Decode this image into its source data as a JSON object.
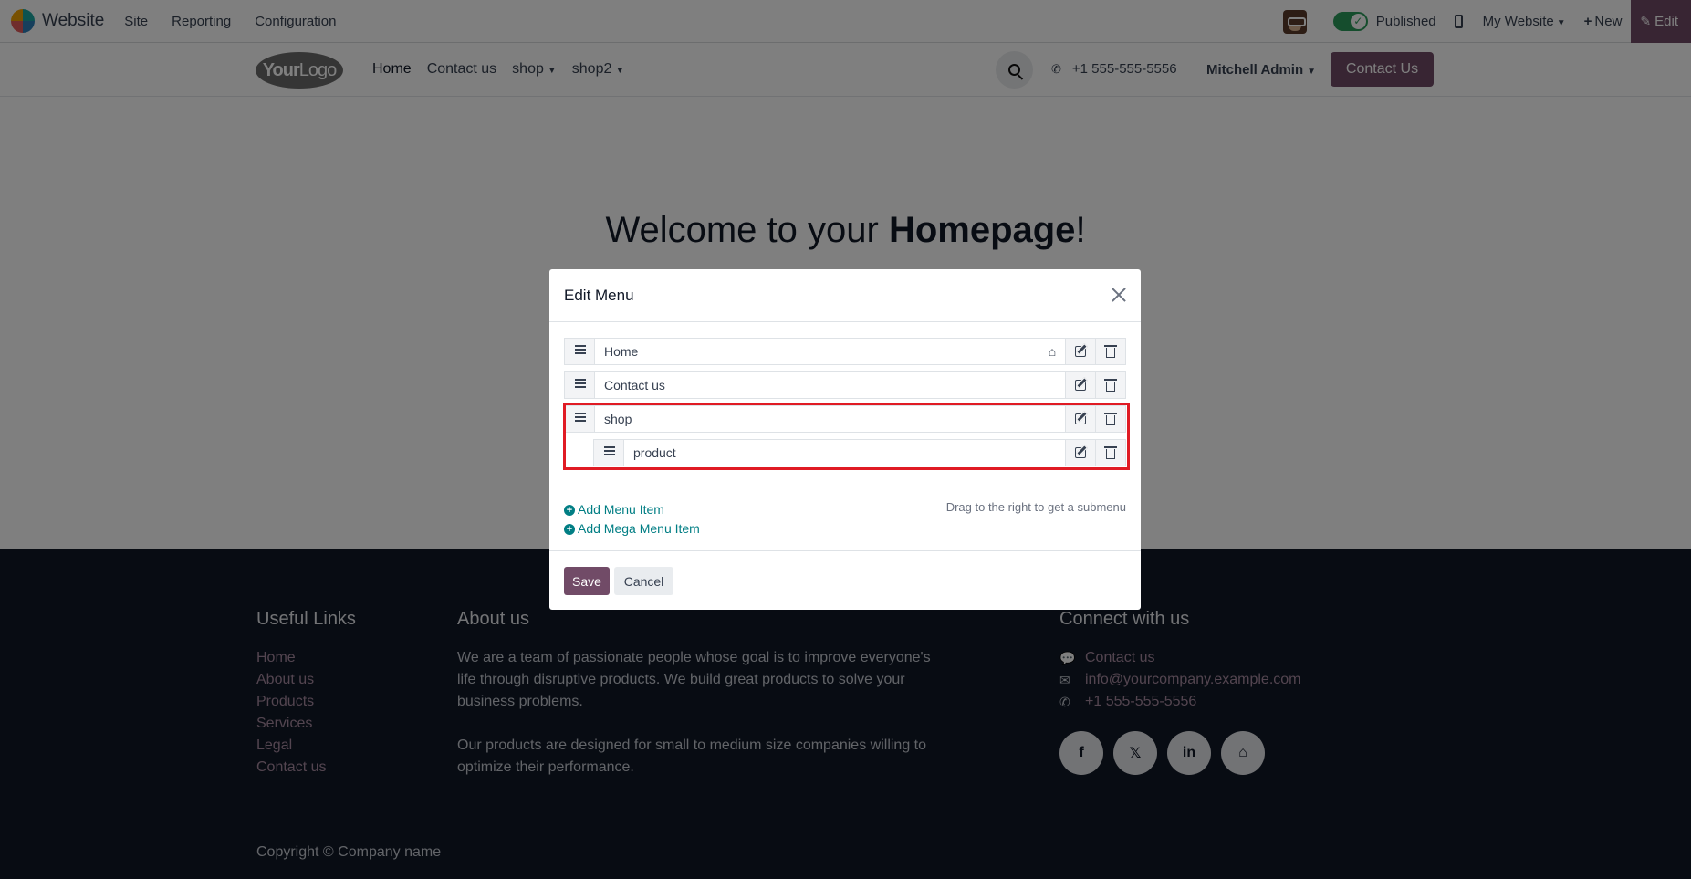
{
  "admin_bar": {
    "app_name": "Website",
    "menu": [
      "Site",
      "Reporting",
      "Configuration"
    ],
    "published_label": "Published",
    "site_switch": "My Website",
    "new_label": "New",
    "edit_label": "Edit",
    "accent_color": "#714b67"
  },
  "site_header": {
    "logo_text_a": "Your",
    "logo_text_b": "Logo",
    "nav": [
      "Home",
      "Contact us",
      "shop",
      "shop2"
    ],
    "phone": "+1 555-555-5556",
    "user": "Mitchell Admin",
    "contact_button": "Contact Us"
  },
  "hero": {
    "prefix": "Welcome to your ",
    "emphasis": "Homepage",
    "suffix": "!"
  },
  "footer": {
    "useful_links_title": "Useful Links",
    "useful_links": [
      "Home",
      "About us",
      "Products",
      "Services",
      "Legal",
      "Contact us"
    ],
    "about_title": "About us",
    "about_p1": "We are a team of passionate people whose goal is to improve everyone's life through disruptive products. We build great products to solve your business problems.",
    "about_p2": "Our products are designed for small to medium size companies willing to optimize their performance.",
    "connect_title": "Connect with us",
    "contact_link": "Contact us",
    "email": "info@yourcompany.example.com",
    "phone": "+1 555-555-5556",
    "socials": [
      "facebook-icon",
      "x-icon",
      "linkedin-icon",
      "home-icon"
    ],
    "social_glyphs": [
      "f",
      "𝕏",
      "in",
      "⌂"
    ],
    "copyright": "Copyright © Company name"
  },
  "modal": {
    "title": "Edit Menu",
    "items": [
      {
        "label": "Home",
        "is_homepage": true,
        "level": 0
      },
      {
        "label": "Contact us",
        "is_homepage": false,
        "level": 0
      },
      {
        "label": "shop",
        "is_homepage": false,
        "level": 0
      },
      {
        "label": "product",
        "is_homepage": false,
        "level": 1
      }
    ],
    "add_menu_item": "Add Menu Item",
    "add_mega_menu_item": "Add Mega Menu Item",
    "hint": "Drag to the right to get a submenu",
    "save_label": "Save",
    "cancel_label": "Cancel",
    "highlight_color": "#e01b24"
  }
}
